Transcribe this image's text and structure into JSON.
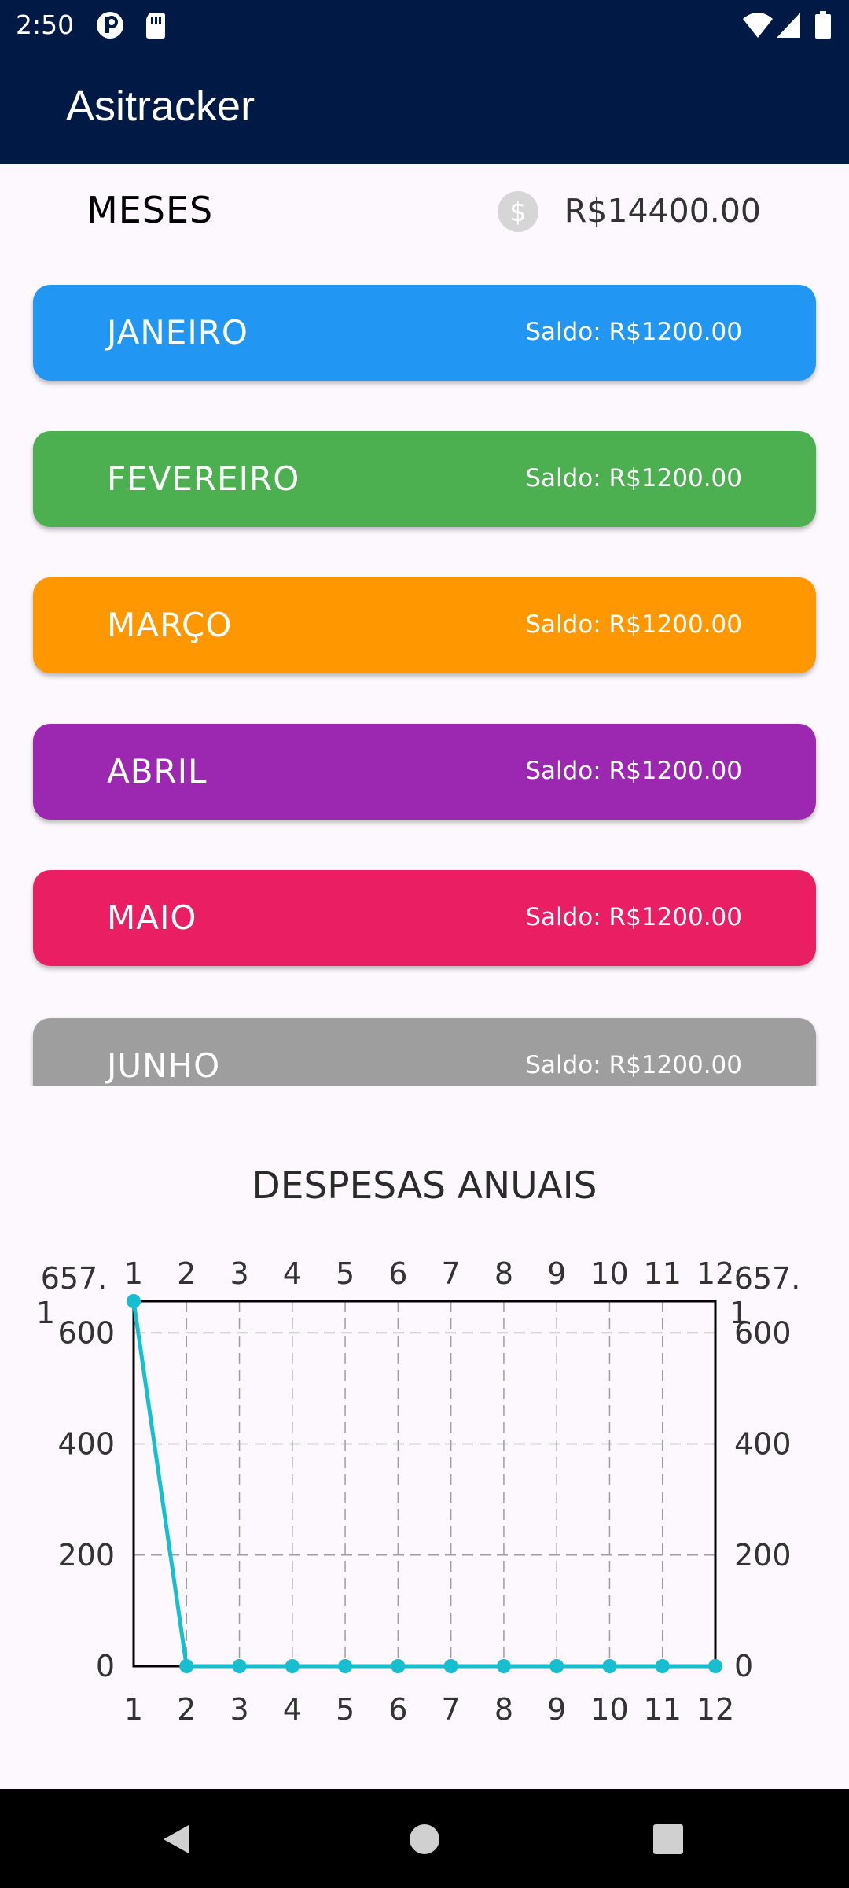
{
  "status_bar": {
    "time": "2:50",
    "icons": [
      "p-icon",
      "sim-card-icon",
      "wifi-icon",
      "signal-icon",
      "battery-icon"
    ]
  },
  "app_bar": {
    "title": "Asitracker"
  },
  "summary": {
    "title": "MESES",
    "total": "R$14400.00",
    "icon": "dollar-icon"
  },
  "months": [
    {
      "name": "JANEIRO",
      "balance": "Saldo: R$1200.00",
      "color": "#2196f3"
    },
    {
      "name": "FEVEREIRO",
      "balance": "Saldo: R$1200.00",
      "color": "#4caf50"
    },
    {
      "name": "MARÇO",
      "balance": "Saldo: R$1200.00",
      "color": "#ff9800"
    },
    {
      "name": "ABRIL",
      "balance": "Saldo: R$1200.00",
      "color": "#9c27b0"
    },
    {
      "name": "MAIO",
      "balance": "Saldo: R$1200.00",
      "color": "#e91e63"
    },
    {
      "name": "JUNHO",
      "balance": "Saldo: R$1200.00",
      "color": "#9e9e9e"
    }
  ],
  "chart_data": {
    "type": "line",
    "title": "DESPESAS ANUAIS",
    "x": [
      1,
      2,
      3,
      4,
      5,
      6,
      7,
      8,
      9,
      10,
      11,
      12
    ],
    "values": [
      657.1,
      0,
      0,
      0,
      0,
      0,
      0,
      0,
      0,
      0,
      0,
      0
    ],
    "xlim": [
      1,
      12
    ],
    "ylim": [
      0,
      657.1
    ],
    "y_ticks": [
      0,
      200,
      400,
      600
    ],
    "y_top_label": "657.1",
    "grid": true,
    "color": "#17becf"
  },
  "nav_bar": {
    "icons": [
      "back-icon",
      "home-icon",
      "recents-icon"
    ]
  }
}
